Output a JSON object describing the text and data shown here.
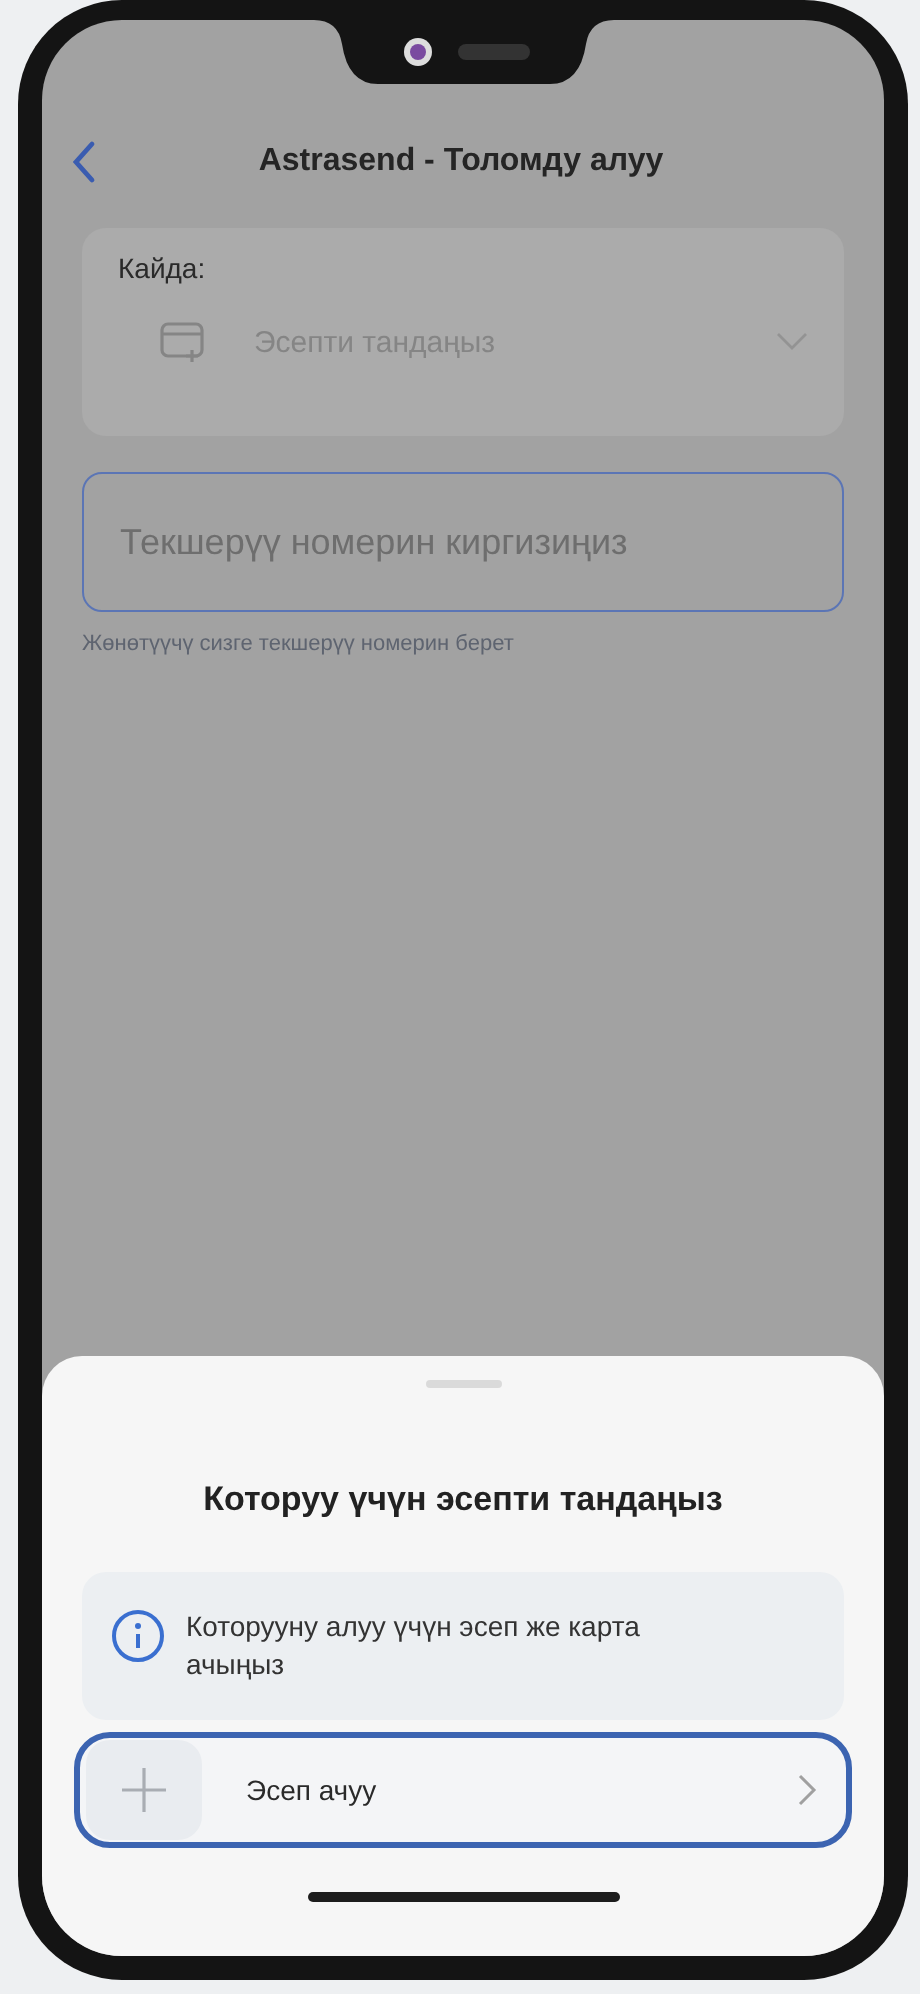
{
  "header": {
    "title": "Astrasend - Толомду алуу"
  },
  "form": {
    "destination_label": "Кайда:",
    "account_select": {
      "placeholder": "Эсепти тандаңыз"
    },
    "code_field": {
      "placeholder": "Текшерүү номерин киргизиңиз"
    },
    "code_hint": "Жөнөтүүчү сизге текшерүү номерин берет"
  },
  "sheet": {
    "title": "Которуу үчүн эсепти тандаңыз",
    "info": "Которууну алуу үчүн эсеп же карта ачыңыз",
    "action": {
      "label": "Эсеп ачуу",
      "highlighted": true
    }
  }
}
